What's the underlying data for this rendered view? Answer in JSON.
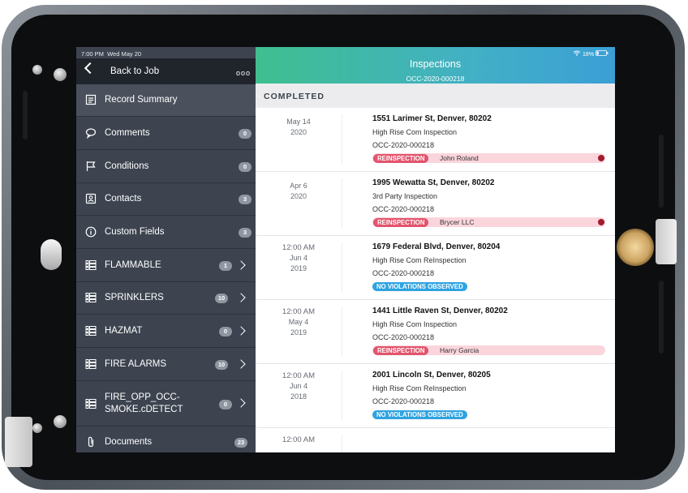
{
  "status_bar": {
    "time": "7:00 PM",
    "date": "Wed May 20",
    "battery": "18%"
  },
  "nav": {
    "back_label": "Back to Job",
    "more_label": "ooo",
    "items": [
      {
        "label": "Record Summary",
        "count": "",
        "icon": "record-summary-icon",
        "chevron": false
      },
      {
        "label": "Comments",
        "count": "0",
        "icon": "comments-icon",
        "chevron": false
      },
      {
        "label": "Conditions",
        "count": "0",
        "icon": "flag-icon",
        "chevron": false
      },
      {
        "label": "Contacts",
        "count": "3",
        "icon": "contacts-icon",
        "chevron": false
      },
      {
        "label": "Custom Fields",
        "count": "3",
        "icon": "info-icon",
        "chevron": false
      },
      {
        "label": "FLAMMABLE",
        "count": "1",
        "icon": "list-icon",
        "chevron": true
      },
      {
        "label": "SPRINKLERS",
        "count": "10",
        "icon": "list-icon",
        "chevron": true
      },
      {
        "label": "HAZMAT",
        "count": "0",
        "icon": "list-icon",
        "chevron": true
      },
      {
        "label": "FIRE ALARMS",
        "count": "10",
        "icon": "list-icon",
        "chevron": true
      },
      {
        "label_line1": "FIRE_OPP_OCC-",
        "label_line2": "SMOKE.cDETECT",
        "count": "0",
        "icon": "list-icon",
        "chevron": true
      },
      {
        "label": "Documents",
        "count": "23",
        "icon": "paperclip-icon",
        "chevron": false
      }
    ]
  },
  "header": {
    "title": "Inspections",
    "subtitle": "OCC-2020-000218"
  },
  "section": {
    "label": "COMPLETED"
  },
  "inspections": [
    {
      "time": "",
      "date_line1": "May 14",
      "date_line2": "2020",
      "address": "1551 Larimer St, Denver, 80202",
      "type": "High Rise Com Inspection",
      "record": "OCC-2020-000218",
      "status": "REINSPECTION",
      "status_color": "#e2546c",
      "inspector": "John Roland",
      "flag": true
    },
    {
      "time": "",
      "date_line1": "Apr 6",
      "date_line2": "2020",
      "address": "1995 Wewatta St, Denver, 80202",
      "type": "3rd Party Inspection",
      "record": "OCC-2020-000218",
      "status": "REINSPECTION",
      "status_color": "#e2546c",
      "inspector": "Brycer LLC",
      "flag": true
    },
    {
      "time": "12:00 AM",
      "date_line1": "Jun 4",
      "date_line2": "2019",
      "address": "1679 Federal Blvd, Denver, 80204",
      "type": "High Rise Com ReInspection",
      "record": "OCC-2020-000218",
      "status": "NO VIOLATIONS OBSERVED",
      "status_color": "#2fa3e1",
      "inspector": "",
      "flag": false
    },
    {
      "time": "12:00 AM",
      "date_line1": "May 4",
      "date_line2": "2019",
      "address": "1441 Little Raven St, Denver, 80202",
      "type": "High Rise Com Inspection",
      "record": "OCC-2020-000218",
      "status": "REINSPECTION",
      "status_color": "#e2546c",
      "inspector": "Harry Garcia",
      "flag": false
    },
    {
      "time": "12:00 AM",
      "date_line1": "Jun 4",
      "date_line2": "2018",
      "address": "2001 Lincoln St, Denver, 80205",
      "type": "High Rise Com ReInspection",
      "record": "OCC-2020-000218",
      "status": "NO VIOLATIONS OBSERVED",
      "status_color": "#2fa3e1",
      "inspector": "",
      "flag": false
    },
    {
      "time": "12:00 AM",
      "date_line1": "",
      "date_line2": "",
      "address": "",
      "type": "",
      "record": "",
      "status": "",
      "status_color": "",
      "inspector": "",
      "flag": false
    }
  ]
}
